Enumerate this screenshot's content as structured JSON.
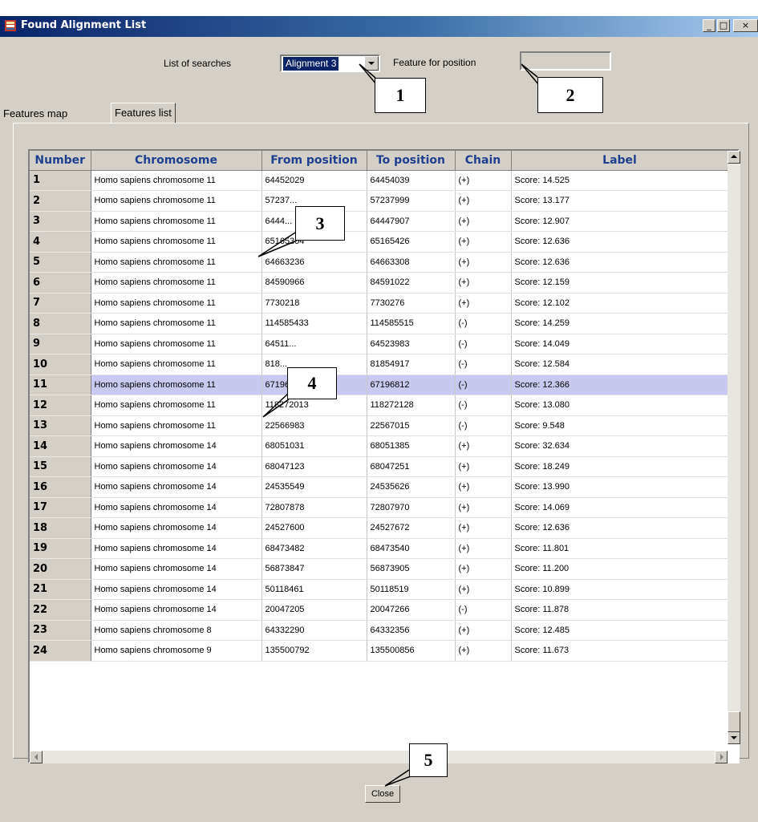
{
  "window": {
    "title": "Found Alignment List",
    "controls": [
      "_",
      "□",
      "×"
    ]
  },
  "toolbar": {
    "searches_label": "List of searches",
    "searches_value": "Alignment 3",
    "feature_label": "Feature for position",
    "feature_value": ""
  },
  "tabs": [
    {
      "label": "Features map",
      "active": false
    },
    {
      "label": "Features list",
      "active": true
    }
  ],
  "table": {
    "columns": [
      "Number",
      "Chromosome",
      "From position",
      "To position",
      "Chain",
      "Label"
    ],
    "selected_row": 11,
    "rows": [
      [
        "1",
        "Homo sapiens chromosome 11",
        "64452029",
        "64454039",
        "(+)",
        "Score: 14.525"
      ],
      [
        "2",
        "Homo sapiens chromosome 11",
        "57237...",
        "57237999",
        "(+)",
        "Score: 13.177"
      ],
      [
        "3",
        "Homo sapiens chromosome 11",
        "6444...",
        "64447907",
        "(+)",
        "Score: 12.907"
      ],
      [
        "4",
        "Homo sapiens chromosome 11",
        "65165354",
        "65165426",
        "(+)",
        "Score: 12.636"
      ],
      [
        "5",
        "Homo sapiens chromosome 11",
        "64663236",
        "64663308",
        "(+)",
        "Score: 12.636"
      ],
      [
        "6",
        "Homo sapiens chromosome 11",
        "84590966",
        "84591022",
        "(+)",
        "Score: 12.159"
      ],
      [
        "7",
        "Homo sapiens chromosome 11",
        "7730218",
        "7730276",
        "(+)",
        "Score: 12.102"
      ],
      [
        "8",
        "Homo sapiens chromosome 11",
        "114585433",
        "114585515",
        "(-)",
        "Score: 14.259"
      ],
      [
        "9",
        "Homo sapiens chromosome 11",
        "64511...",
        "64523983",
        "(-)",
        "Score: 14.049"
      ],
      [
        "10",
        "Homo sapiens chromosome 11",
        "818...",
        "81854917",
        "(-)",
        "Score: 12.584"
      ],
      [
        "11",
        "Homo sapiens chromosome 11",
        "67196740",
        "67196812",
        "(-)",
        "Score: 12.366"
      ],
      [
        "12",
        "Homo sapiens chromosome 11",
        "118272013",
        "118272128",
        "(-)",
        "Score: 13.080"
      ],
      [
        "13",
        "Homo sapiens chromosome 11",
        "22566983",
        "22567015",
        "(-)",
        "Score: 9.548"
      ],
      [
        "14",
        "Homo sapiens chromosome 14",
        "68051031",
        "68051385",
        "(+)",
        "Score: 32.634"
      ],
      [
        "15",
        "Homo sapiens chromosome 14",
        "68047123",
        "68047251",
        "(+)",
        "Score: 18.249"
      ],
      [
        "16",
        "Homo sapiens chromosome 14",
        "24535549",
        "24535626",
        "(+)",
        "Score: 13.990"
      ],
      [
        "17",
        "Homo sapiens chromosome 14",
        "72807878",
        "72807970",
        "(+)",
        "Score: 14.069"
      ],
      [
        "18",
        "Homo sapiens chromosome 14",
        "24527600",
        "24527672",
        "(+)",
        "Score: 12.636"
      ],
      [
        "19",
        "Homo sapiens chromosome 14",
        "68473482",
        "68473540",
        "(+)",
        "Score: 11.801"
      ],
      [
        "20",
        "Homo sapiens chromosome 14",
        "56873847",
        "56873905",
        "(+)",
        "Score: 11.200"
      ],
      [
        "21",
        "Homo sapiens chromosome 14",
        "50118461",
        "50118519",
        "(+)",
        "Score: 10.899"
      ],
      [
        "22",
        "Homo sapiens chromosome 14",
        "20047205",
        "20047266",
        "(-)",
        "Score: 11.878"
      ],
      [
        "23",
        "Homo sapiens chromosome 8",
        "64332290",
        "64332356",
        "(+)",
        "Score: 12.485"
      ],
      [
        "24",
        "Homo sapiens chromosome 9",
        "135500792",
        "135500856",
        "(+)",
        "Score: 11.673"
      ]
    ]
  },
  "close_label": "Close",
  "callouts": [
    "1",
    "2",
    "3",
    "4",
    "5"
  ],
  "colors": {
    "selected_row": "#c8c8f0",
    "header_text": "#1f3f8f",
    "window_bg": "#d4d0c8",
    "title_bar": "#0a246a"
  }
}
